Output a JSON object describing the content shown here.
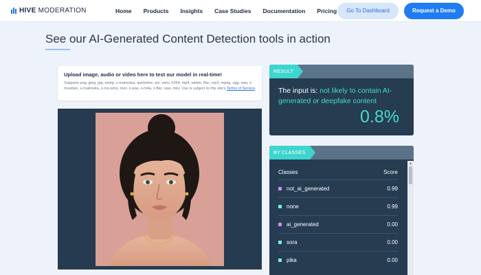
{
  "header": {
    "logo_bold": "HIVE",
    "logo_light": "MODERATION",
    "nav": [
      "Home",
      "Products",
      "Insights",
      "Case Studies",
      "Documentation",
      "Pricing"
    ],
    "dashboard_button": "Go To Dashboard",
    "demo_button": "Request a Demo"
  },
  "main": {
    "title": "See our AI-Generated Content Detection tools in action"
  },
  "upload": {
    "heading": "Upload image, audio or video here to test our model in real-time!",
    "supports": "Supports png, jpeg, jpg, webp, x-matroska, quicktime, avi, wmv, h264, mp4, webm, flac, mp3, mpeg, ogg, wav, x-msvideo, x-matroska, x-ms-wmv, mov, x-wav, x-m4a, x-flac, wav, mkv. Use is subject to this site's",
    "tos_link": "Terms of Service",
    "tos_suffix": "."
  },
  "result": {
    "tag": "RESULT",
    "prefix": "The input is:",
    "verdict": "not likely to contain AI-generated or deepfake content",
    "score": "0.8%"
  },
  "classes": {
    "tag": "BY CLASSES",
    "col_classes": "Classes",
    "col_score": "Score",
    "rows": [
      {
        "name": "not_ai_generated",
        "score": "0.99",
        "color": "#d78cf0"
      },
      {
        "name": "none",
        "score": "0.99",
        "color": "#7ee6f0"
      },
      {
        "name": "ai_generated",
        "score": "0.00",
        "color": "#d78cf0"
      },
      {
        "name": "sora",
        "score": "0.00",
        "color": "#7ee6f0"
      },
      {
        "name": "pika",
        "score": "0.00",
        "color": "#7ee6f0"
      }
    ]
  },
  "colors": {
    "accent": "#1f7cf3",
    "teal": "#3dd5cd",
    "panel": "#253c51"
  }
}
